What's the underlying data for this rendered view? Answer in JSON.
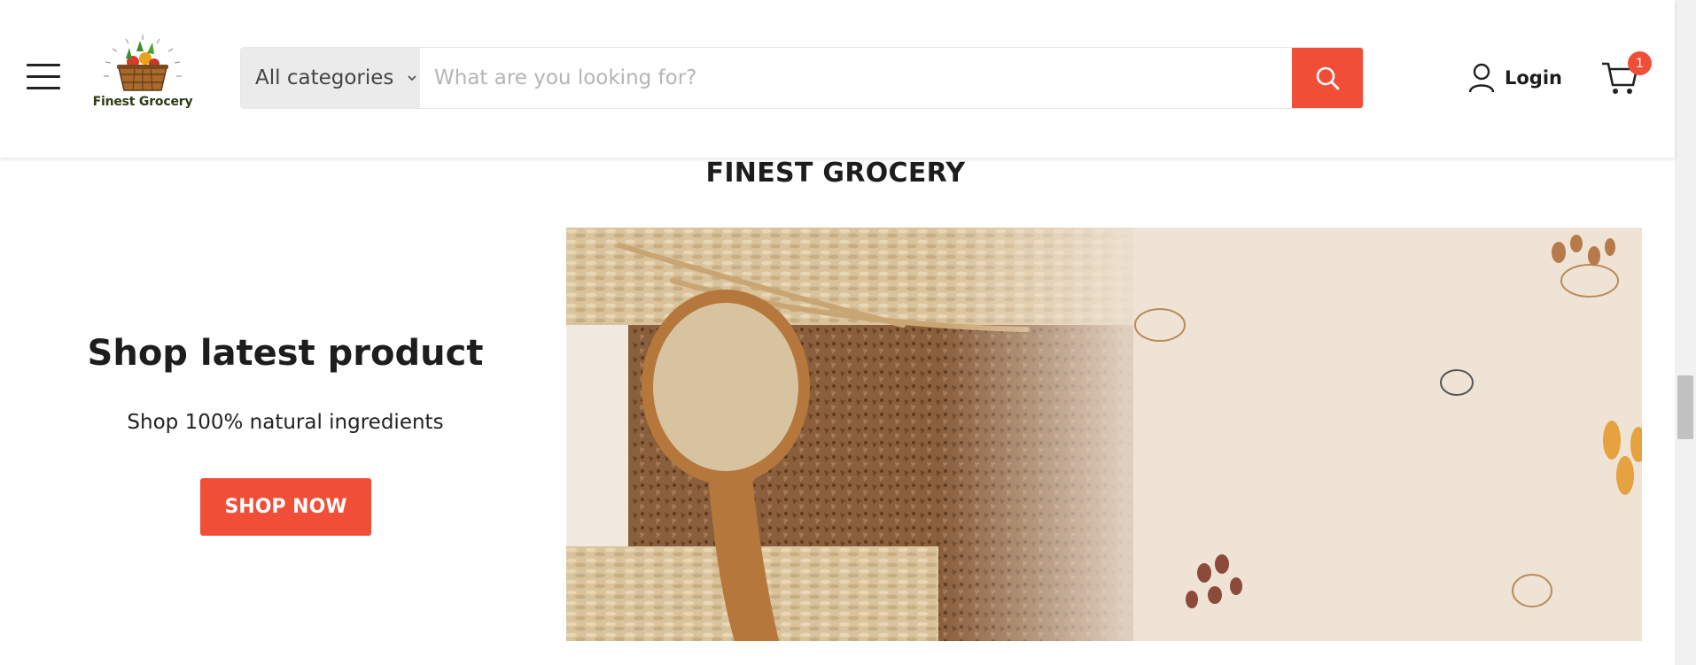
{
  "header": {
    "logo_text": "Finest Grocery",
    "search": {
      "category_label": "All categories",
      "placeholder": "What are you looking for?"
    },
    "login_label": "Login",
    "cart_count": "1"
  },
  "section": {
    "title": "FINEST GROCERY",
    "heading": "Shop latest product",
    "subheading": "Shop 100% natural ingredients",
    "cta_label": "SHOP NOW"
  },
  "colors": {
    "accent": "#f04e37",
    "text": "#1d1d1d",
    "banner_background": "#efe3d6"
  }
}
